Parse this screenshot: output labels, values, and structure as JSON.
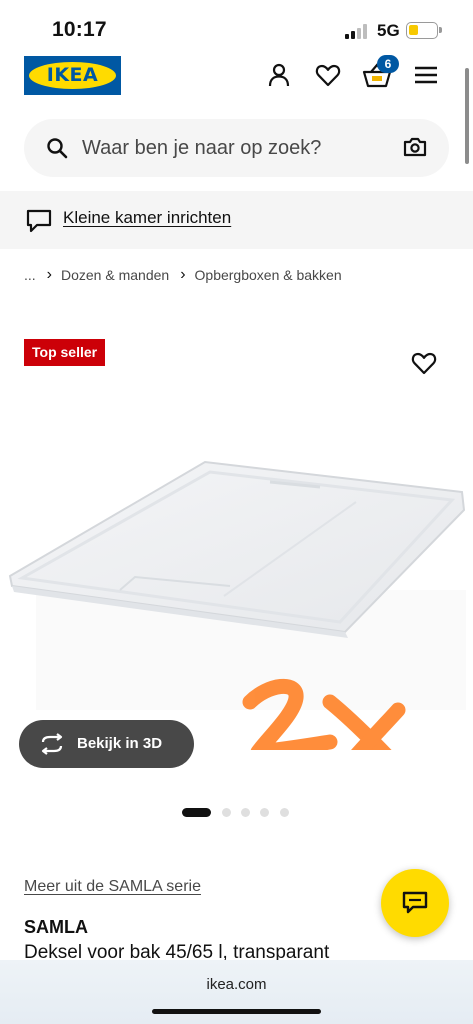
{
  "status": {
    "time": "10:17",
    "network": "5G",
    "battery_level": 0.35
  },
  "header": {
    "logo_text": "IKEA",
    "cart_count": "6",
    "icons": [
      "user-icon",
      "heart-icon",
      "cart-icon",
      "menu-icon"
    ]
  },
  "search": {
    "placeholder": "Waar ben je naar op zoek?",
    "value": ""
  },
  "promo": {
    "link_text": "Kleine kamer inrichten"
  },
  "breadcrumb": {
    "items": [
      "...",
      "Dozen & manden",
      "Opbergboxen & bakken"
    ]
  },
  "product": {
    "badge": "Top seller",
    "view_3d_label": "Bekijk in 3D",
    "carousel_count": 5,
    "carousel_active": 1,
    "series_link": "Meer uit de SAMLA serie",
    "name": "SAMLA",
    "description": "Deksel voor bak 45/65 l, transparant",
    "annotation": "2x"
  },
  "browser": {
    "url": "ikea.com"
  },
  "colors": {
    "ikea_blue": "#0058a3",
    "ikea_yellow": "#ffdb00",
    "top_seller_red": "#cc0008",
    "annotation_orange": "#ff7a1a"
  }
}
